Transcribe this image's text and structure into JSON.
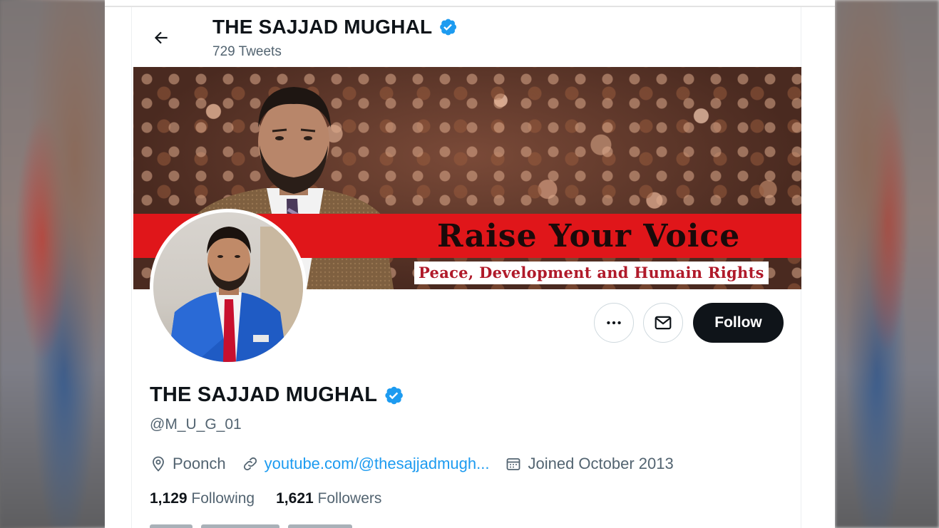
{
  "header": {
    "title": "THE SAJJAD MUGHAL",
    "tweet_count": "729 Tweets",
    "back_icon": "arrow-left-icon"
  },
  "banner": {
    "slogan": "Raise Your Voice",
    "subslogan": "Peace, Development and Humain Rights"
  },
  "actions": {
    "more_icon": "more-dots-icon",
    "message_icon": "mail-icon",
    "follow_label": "Follow"
  },
  "profile": {
    "name": "THE SAJJAD MUGHAL",
    "handle": "@M_U_G_01",
    "verified": true,
    "location": "Poonch",
    "website": "youtube.com/@thesajjadmugh...",
    "joined": "Joined October 2013",
    "following_count": "1,129",
    "following_label": "Following",
    "followers_count": "1,621",
    "followers_label": "Followers"
  },
  "colors": {
    "verified_blue": "#1d9bf0",
    "follow_button": "#0f1419",
    "banner_red": "#e0161a",
    "secondary_text": "#536471"
  }
}
